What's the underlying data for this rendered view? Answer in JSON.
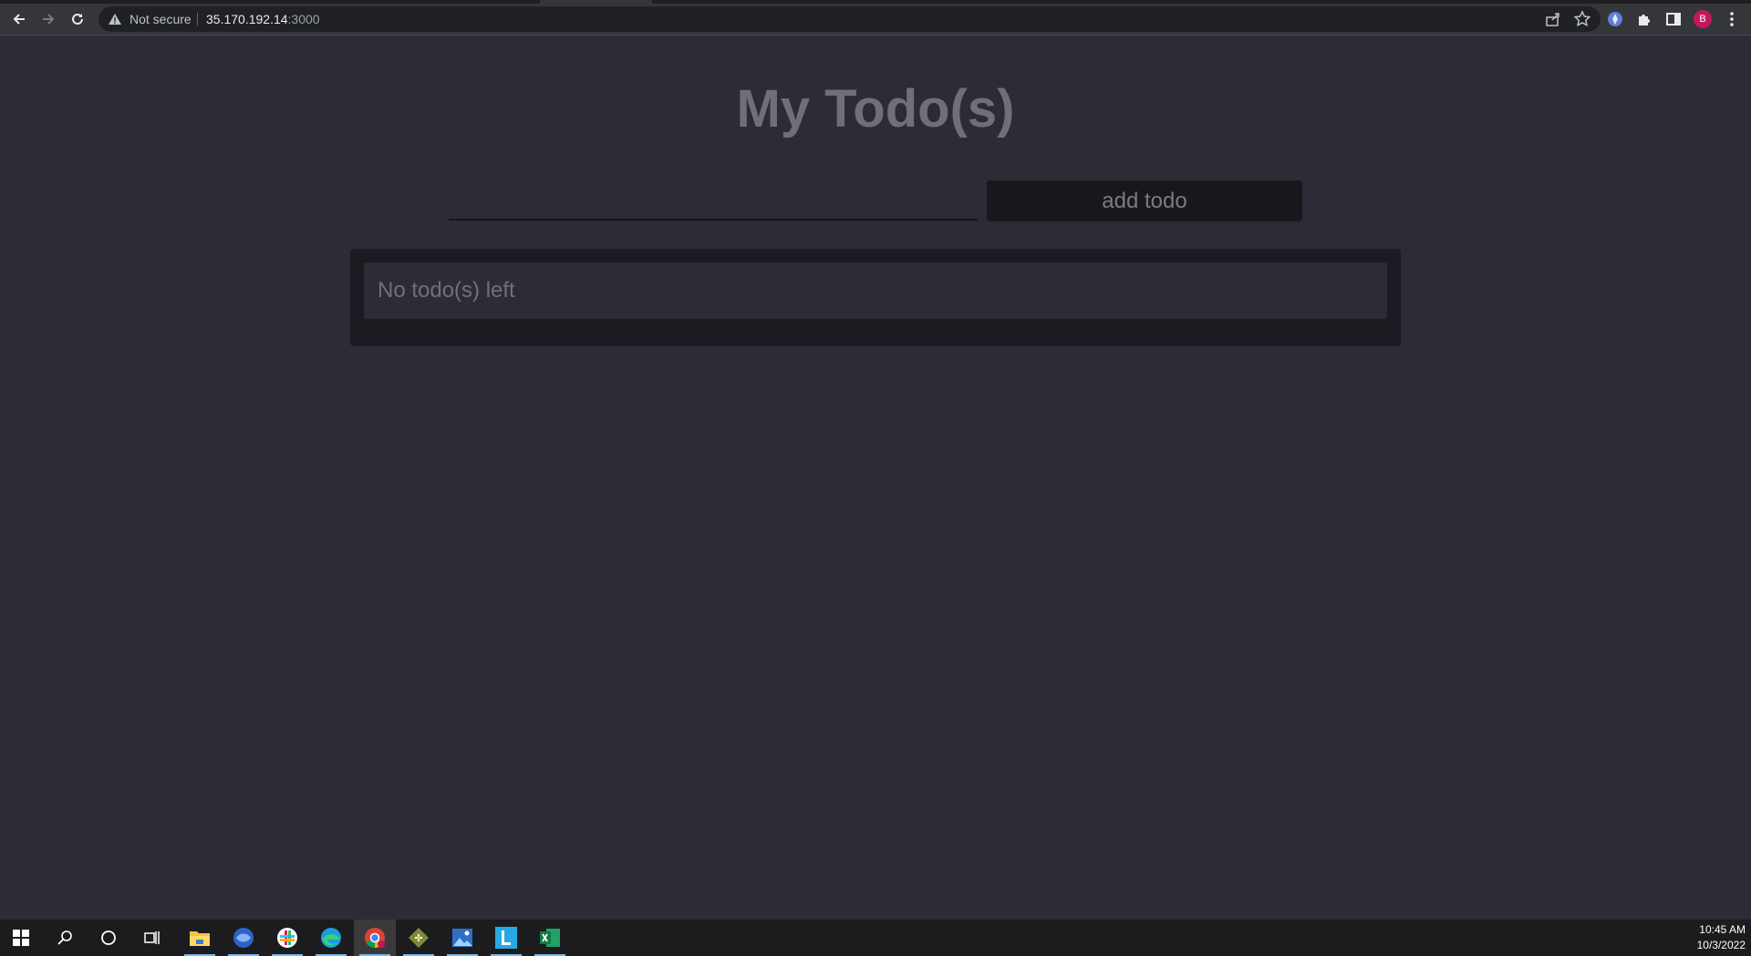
{
  "browser": {
    "security_label": "Not secure",
    "url_host": "35.170.192.14",
    "url_port": ":3000",
    "profile_initial": "B"
  },
  "app": {
    "title": "My Todo(s)",
    "input": {
      "value": "",
      "placeholder": ""
    },
    "add_button_label": "add todo",
    "empty_message": "No todo(s) left"
  },
  "taskbar": {
    "apps": [
      "start-icon",
      "search-icon",
      "cortana-icon",
      "task-view-icon",
      "file-explorer-icon",
      "app-icon",
      "slack-icon",
      "edge-icon",
      "chrome-icon",
      "git-icon",
      "photos-icon",
      "lens-icon",
      "excel-icon"
    ],
    "time": "10:45 AM",
    "date": "10/3/2022"
  },
  "colors": {
    "background": "#2b2c35",
    "list_background": "#1b1c21",
    "button_background": "#17181c",
    "title": "#6f7075"
  }
}
